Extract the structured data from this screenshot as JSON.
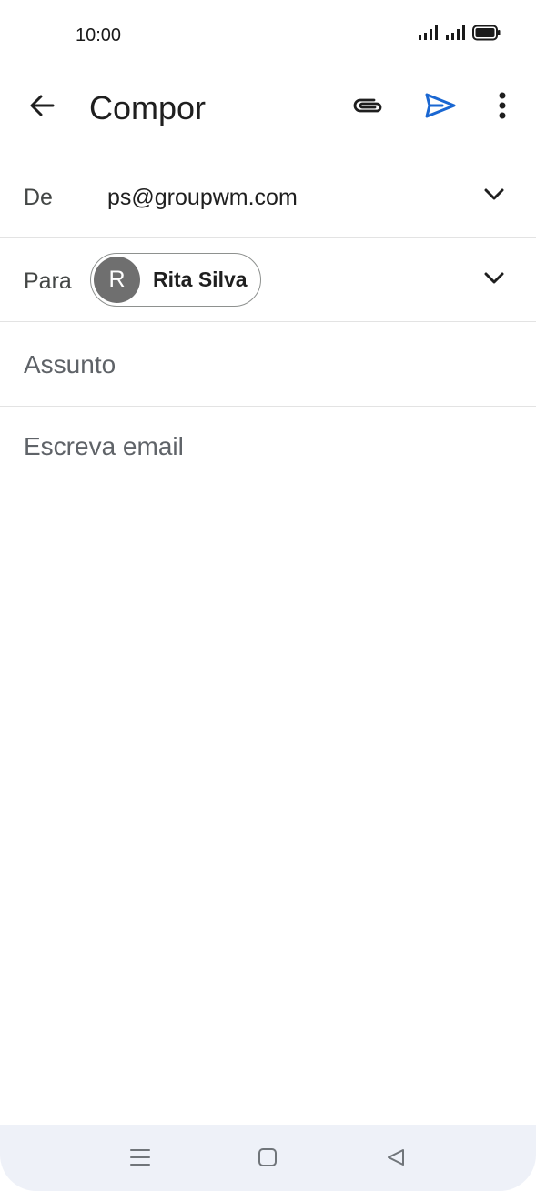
{
  "status_bar": {
    "time": "10:00",
    "icons": [
      "signal-icon",
      "signal-icon",
      "battery-icon"
    ]
  },
  "app_bar": {
    "title": "Compor",
    "icons": [
      "back-arrow-icon",
      "paperclip-icon",
      "send-icon",
      "more-vert-icon"
    ]
  },
  "compose": {
    "from": {
      "label": "De",
      "value": "ps@groupwm.com"
    },
    "to": {
      "label": "Para",
      "recipient_initial": "R",
      "recipient_name": "Rita Silva"
    },
    "subject": {
      "placeholder": "Assunto"
    },
    "body": {
      "placeholder": "Escreva email"
    }
  },
  "nav_bar": {
    "icons": [
      "menu-icon",
      "home-icon",
      "back-triangle-icon"
    ]
  },
  "colors": {
    "accent": "#1a67d2",
    "avatar": "#6f6f6f",
    "nav_background": "#eef1f8"
  }
}
